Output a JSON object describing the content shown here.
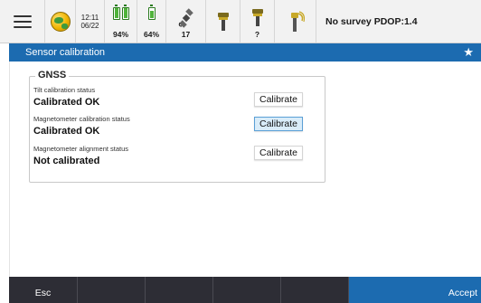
{
  "statusbar": {
    "time": "12:11",
    "date": "06/22",
    "battery1_pct": "94%",
    "battery1_level": 0.94,
    "battery1b_level": 0.94,
    "battery2_pct": "64%",
    "battery2_level": 0.64,
    "satellites": "17",
    "antenna2_value": "?",
    "survey_status": "No survey PDOP:1.4"
  },
  "titlebar": {
    "title": "Sensor calibration"
  },
  "gnss": {
    "legend": "GNSS",
    "rows": [
      {
        "label": "Tilt calibration status",
        "value": "Calibrated OK",
        "button": "Calibrate"
      },
      {
        "label": "Magnetometer calibration status",
        "value": "Calibrated OK",
        "button": "Calibrate"
      },
      {
        "label": "Magnetometer alignment status",
        "value": "Not calibrated",
        "button": "Calibrate"
      }
    ]
  },
  "bottombar": {
    "esc": "Esc",
    "accept": "Accept"
  },
  "colors": {
    "accent": "#1c6bb0",
    "bottom_bar": "#2d2d35",
    "battery_green": "#4fb33a"
  }
}
